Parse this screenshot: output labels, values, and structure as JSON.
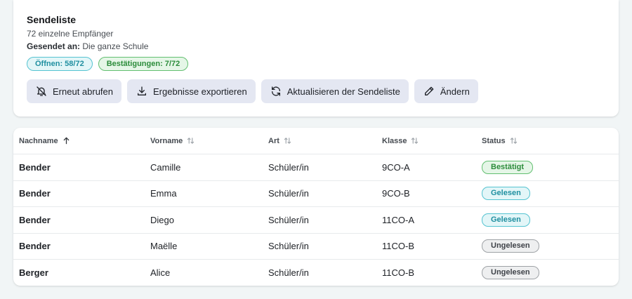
{
  "header": {
    "title": "Sendeliste",
    "recipients": "72 einzelne Empfänger",
    "sent_to_label": "Gesendet an:",
    "sent_to_value": "Die ganze Schule"
  },
  "chips": {
    "opens": "Öffnen: 58/72",
    "confirmations": "Bestätigungen: 7/72"
  },
  "actions": {
    "recall": "Erneut abrufen",
    "export": "Ergebnisse exportieren",
    "refresh": "Aktualisieren der Sendeliste",
    "edit": "Ändern"
  },
  "table": {
    "columns": [
      "Nachname",
      "Vorname",
      "Art",
      "Klasse",
      "Status"
    ],
    "rows": [
      {
        "lastname": "Bender",
        "firstname": "Camille",
        "type": "Schüler/in",
        "class": "9CO-A",
        "status": "Bestätigt"
      },
      {
        "lastname": "Bender",
        "firstname": "Emma",
        "type": "Schüler/in",
        "class": "9CO-B",
        "status": "Gelesen"
      },
      {
        "lastname": "Bender",
        "firstname": "Diego",
        "type": "Schüler/in",
        "class": "11CO-A",
        "status": "Gelesen"
      },
      {
        "lastname": "Bender",
        "firstname": "Maëlle",
        "type": "Schüler/in",
        "class": "11CO-B",
        "status": "Ungelesen"
      },
      {
        "lastname": "Berger",
        "firstname": "Alice",
        "type": "Schüler/in",
        "class": "11CO-B",
        "status": "Ungelesen"
      }
    ]
  },
  "colors": {
    "page_bg": "#f1f5f6",
    "button_bg": "#e4e7f2",
    "status_confirmed": "#2c8c3b",
    "status_read": "#1f8fa0",
    "status_unread": "#3e4248"
  }
}
